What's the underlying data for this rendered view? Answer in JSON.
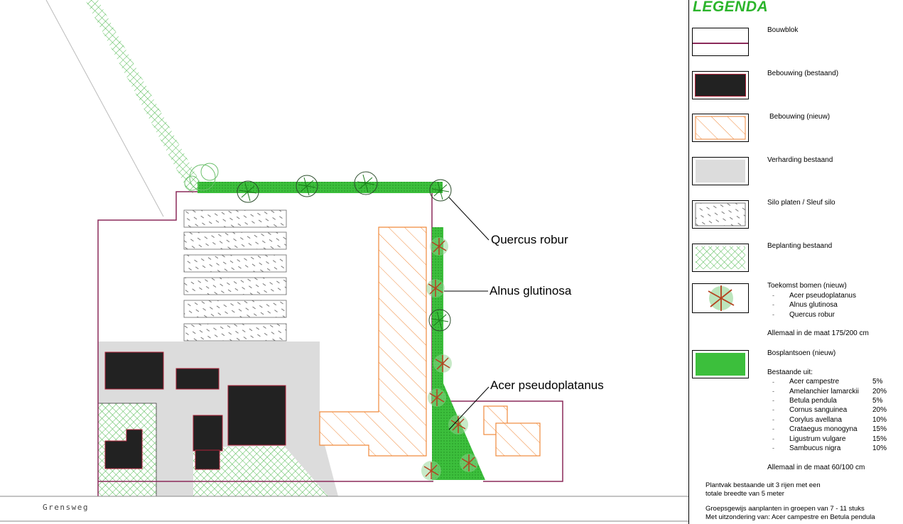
{
  "callouts": {
    "quercus": "Quercus robur",
    "alnus": "Alnus glutinosa",
    "acer": "Acer pseudoplatanus"
  },
  "road_label": "Grensweg",
  "legend": {
    "title": "LEGENDA",
    "items": [
      {
        "label": "Bouwblok"
      },
      {
        "label": "Bebouwing (bestaand)"
      },
      {
        "label": "Bebouwing (nieuw)"
      },
      {
        "label": "Verharding bestaand"
      },
      {
        "label": "Silo platen / Sleuf silo"
      },
      {
        "label": "Beplanting bestaand"
      },
      {
        "label": "Toekomst bomen (nieuw)"
      },
      {
        "label": "Bosplantsoen (nieuw)"
      }
    ],
    "trees": [
      "Acer pseudoplatanus",
      "Alnus glutinosa",
      "Quercus robur"
    ],
    "trees_size": "Allemaal in de maat 175/200 cm",
    "bos_consists": "Bestaande uit:",
    "species": [
      {
        "name": "Acer campestre",
        "pct": "5%"
      },
      {
        "name": "Amelanchier lamarckii",
        "pct": "20%"
      },
      {
        "name": "Betula pendula",
        "pct": "5%"
      },
      {
        "name": "Cornus sanguinea",
        "pct": "20%"
      },
      {
        "name": "Corylus avellana",
        "pct": "10%"
      },
      {
        "name": "Crataegus monogyna",
        "pct": "15%"
      },
      {
        "name": "Ligustrum vulgare",
        "pct": "15%"
      },
      {
        "name": "Sambucus nigra",
        "pct": "10%"
      }
    ],
    "bos_size": "Allemaal in de maat 60/100 cm",
    "note1": "Plantvak bestaande uit 3 rijen met een",
    "note2": "totale breedte van 5 meter",
    "note3": "Groepsgewijs aanplanten in groepen van 7 - 11 stuks",
    "note4": "Met uitzondering van: Acer campestre  en Betula pendula"
  },
  "colors": {
    "boundary": "#8b2a5a",
    "building_existing": "#222222",
    "building_new_stroke": "#f08a3c",
    "paving": "#dcdcdc",
    "planting_existing": "#3aa83a",
    "bos_new": "#36b836",
    "legend_title": "#2cb52c"
  }
}
